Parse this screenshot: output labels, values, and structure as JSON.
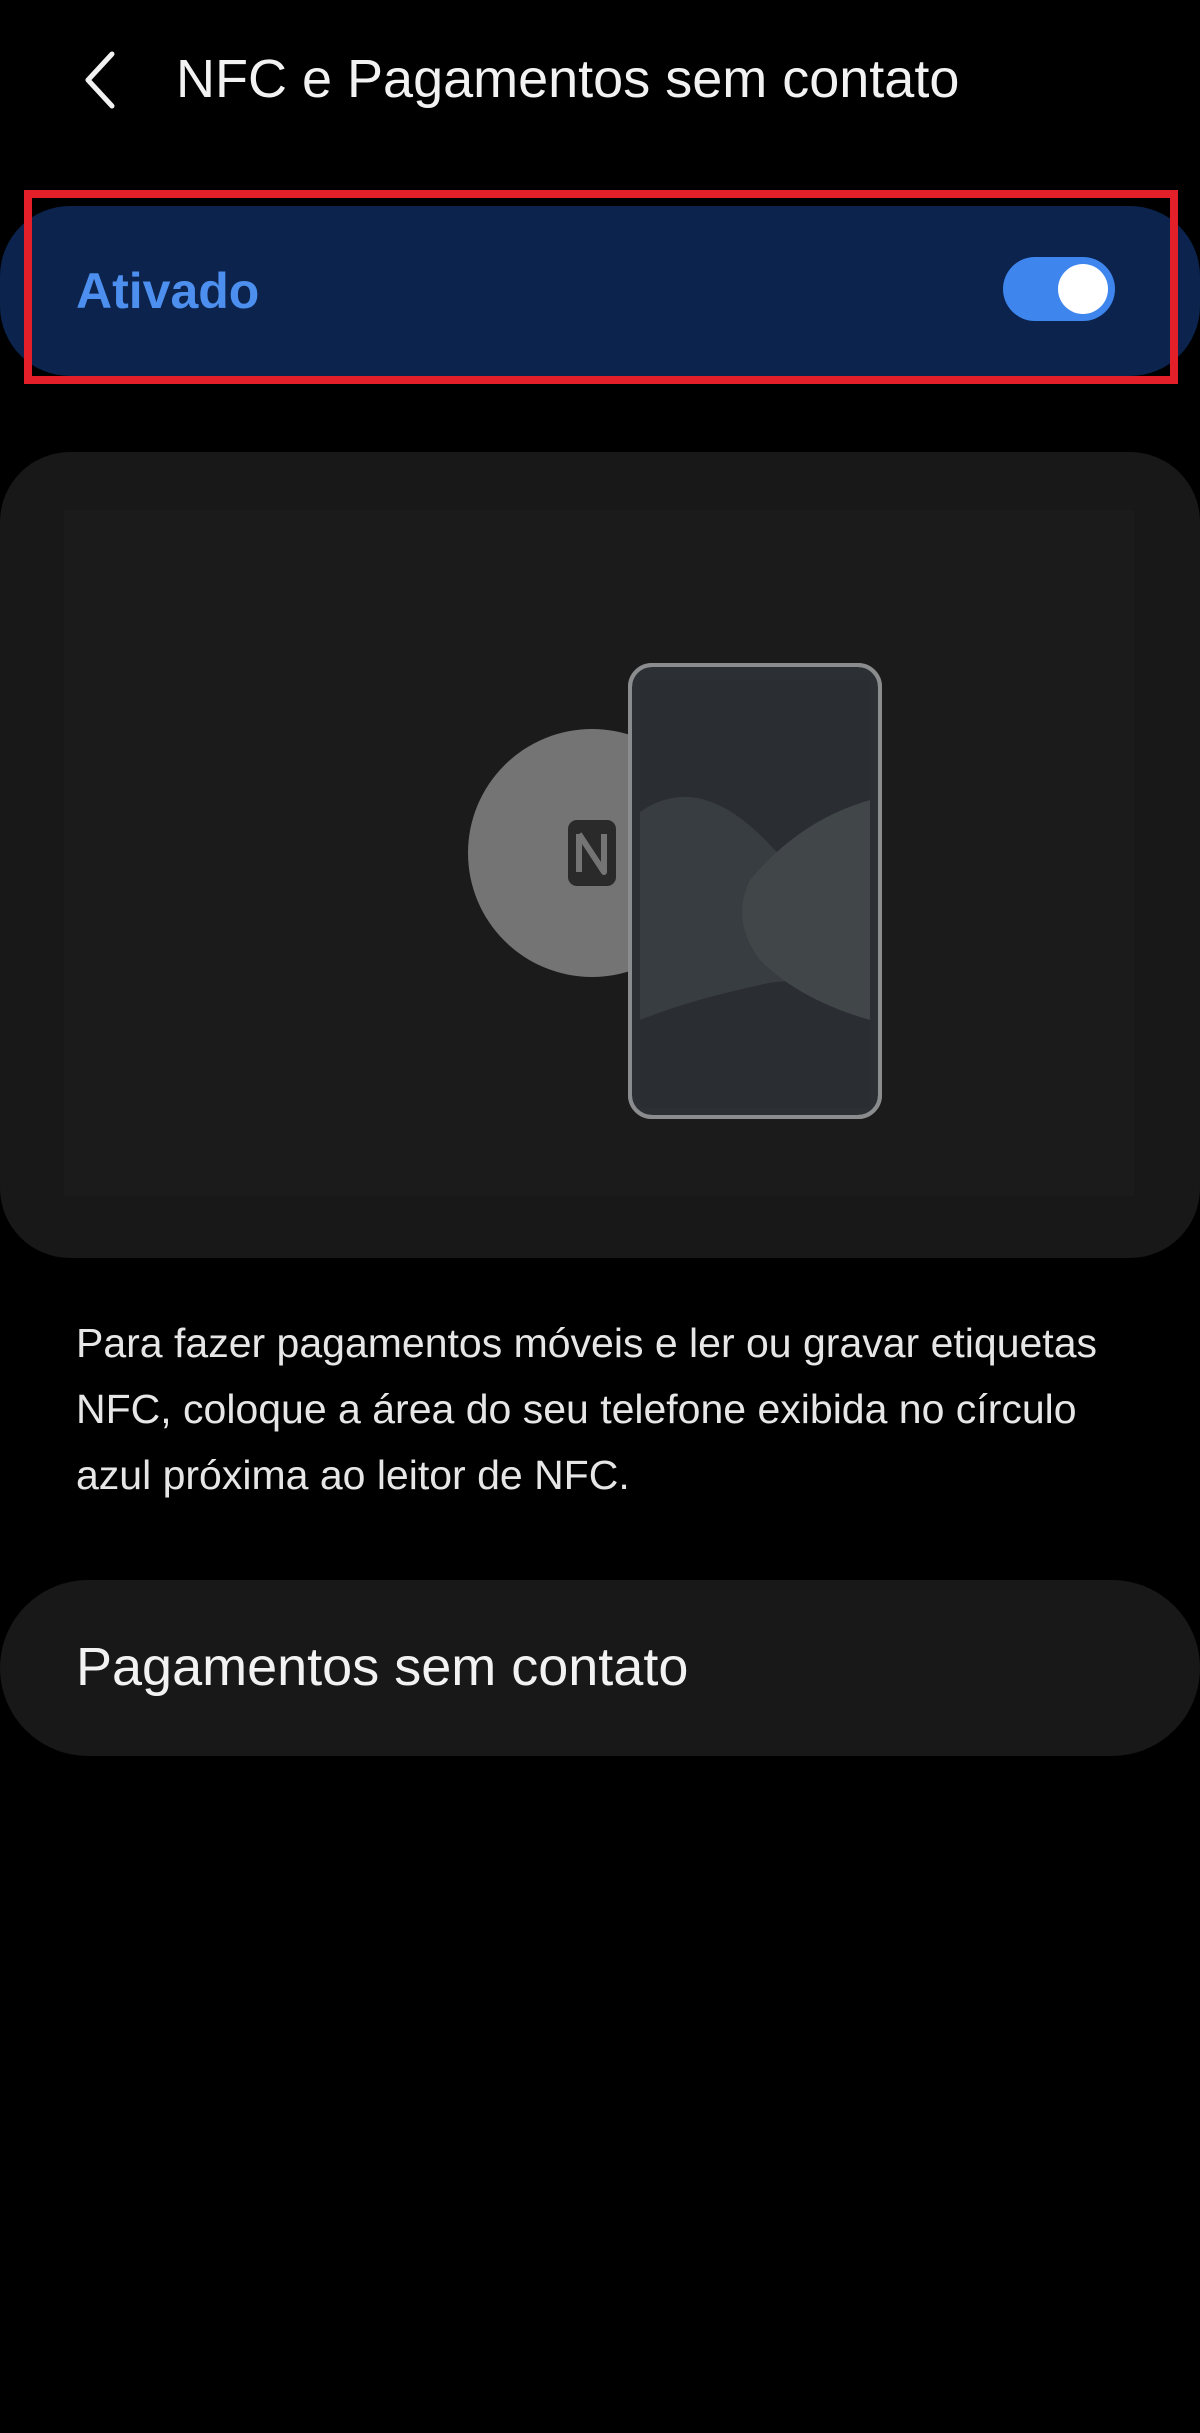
{
  "header": {
    "title": "NFC e Pagamentos sem contato",
    "back_icon": "chevron-left-icon"
  },
  "toggle": {
    "label": "Ativado",
    "state": "on",
    "label_color": "#4c8fee",
    "track_color": "#3e86ee",
    "row_color": "#0b234d",
    "highlight_color": "#e3202a"
  },
  "illustration": {
    "nfc_icon": "nfc-icon",
    "phone_icon": "phone-icon"
  },
  "description": "Para fazer pagamentos móveis e ler ou gravar etiquetas NFC, coloque a área do seu telefone exibida no círculo azul próxima ao leitor de NFC.",
  "menu": {
    "payments_label": "Pagamentos sem contato"
  }
}
